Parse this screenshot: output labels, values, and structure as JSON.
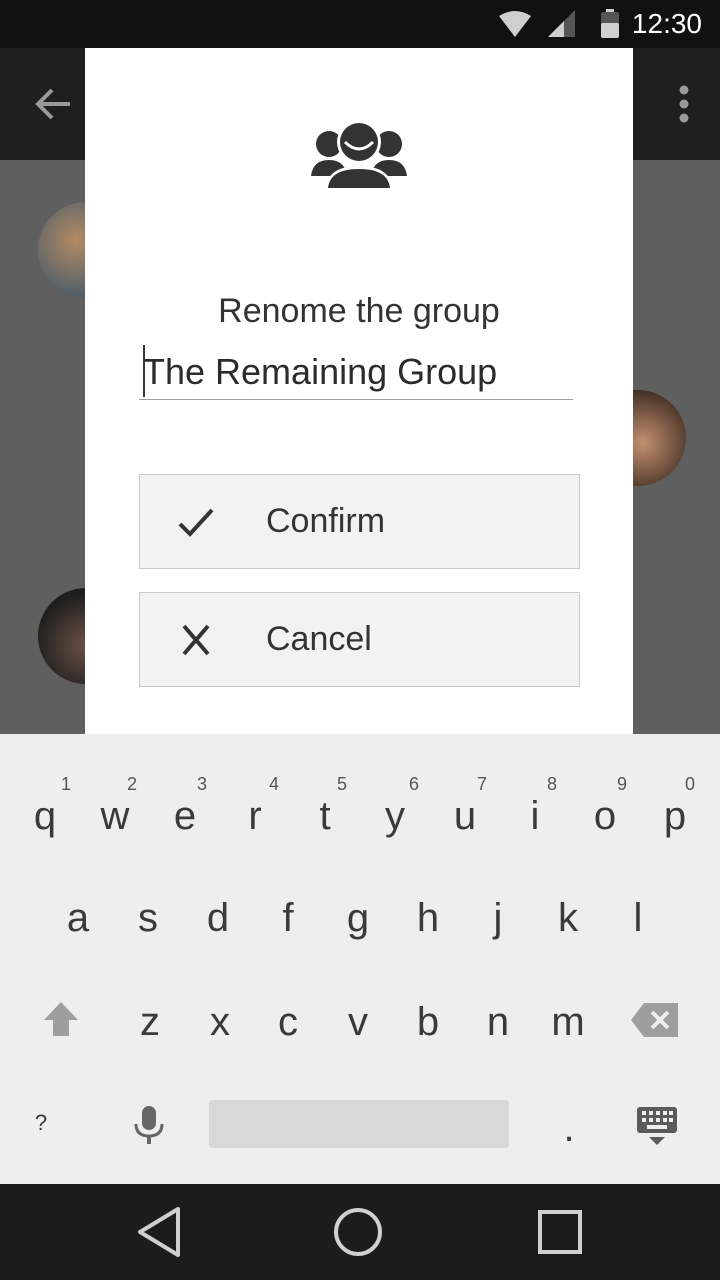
{
  "status_bar": {
    "time": "12:30",
    "icons": [
      "wifi-icon",
      "signal-icon",
      "battery-icon"
    ]
  },
  "app_bar": {
    "icons": [
      "back-arrow-icon",
      "more-vert-icon"
    ]
  },
  "dialog": {
    "icon": "group-icon",
    "title": "Renome the group",
    "input_value": "The Remaining Group",
    "confirm_label": "Confirm",
    "cancel_label": "Cancel"
  },
  "keyboard": {
    "row1": [
      "q",
      "w",
      "e",
      "r",
      "t",
      "y",
      "u",
      "i",
      "o",
      "p"
    ],
    "row1_hints": [
      "1",
      "2",
      "3",
      "4",
      "5",
      "6",
      "7",
      "8",
      "9",
      "0"
    ],
    "row2": [
      "a",
      "s",
      "d",
      "f",
      "g",
      "h",
      "j",
      "k",
      "l"
    ],
    "row3": [
      "z",
      "x",
      "c",
      "v",
      "b",
      "n",
      "m"
    ],
    "symbols_key": "?",
    "period_key": "."
  },
  "nav_bar": {
    "icons": [
      "nav-back-icon",
      "nav-home-icon",
      "nav-recents-icon"
    ]
  }
}
